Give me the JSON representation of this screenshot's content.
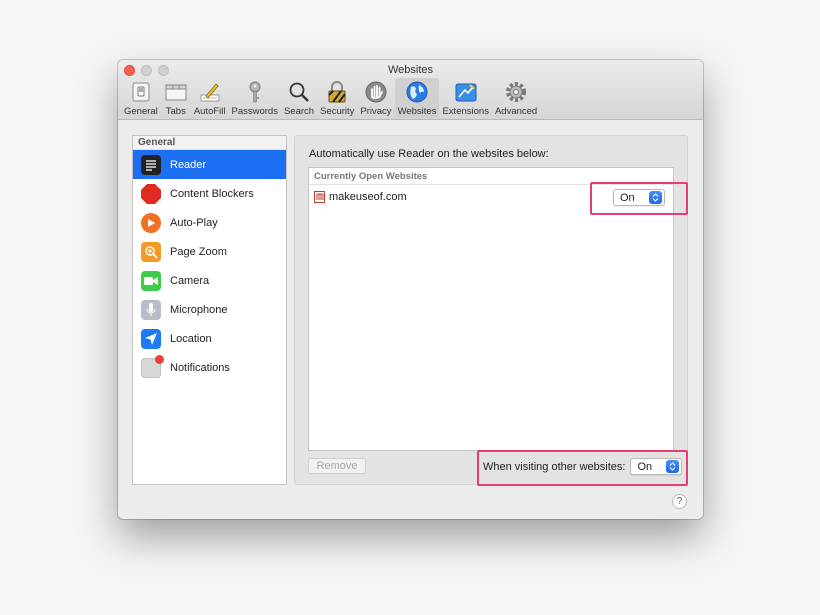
{
  "window": {
    "title": "Websites"
  },
  "toolbar": {
    "items": [
      {
        "label": "General",
        "icon": "general-switch-icon"
      },
      {
        "label": "Tabs",
        "icon": "tabs-icon"
      },
      {
        "label": "AutoFill",
        "icon": "autofill-pencil-icon"
      },
      {
        "label": "Passwords",
        "icon": "key-icon"
      },
      {
        "label": "Search",
        "icon": "magnifier-icon"
      },
      {
        "label": "Security",
        "icon": "padlock-icon"
      },
      {
        "label": "Privacy",
        "icon": "hand-icon"
      },
      {
        "label": "Websites",
        "icon": "globe-icon"
      },
      {
        "label": "Extensions",
        "icon": "puzzle-extensions-icon"
      },
      {
        "label": "Advanced",
        "icon": "gear-icon"
      }
    ],
    "active": "Websites"
  },
  "sidebar": {
    "header": "General",
    "items": [
      {
        "label": "Reader",
        "icon": "reader-icon",
        "color": "#222222"
      },
      {
        "label": "Content Blockers",
        "icon": "stop-sign-icon",
        "color": "#e02b20"
      },
      {
        "label": "Auto-Play",
        "icon": "play-icon",
        "color": "#f27022"
      },
      {
        "label": "Page Zoom",
        "icon": "zoom-icon",
        "color": "#f39a22"
      },
      {
        "label": "Camera",
        "icon": "camera-icon",
        "color": "#3ccc4a"
      },
      {
        "label": "Microphone",
        "icon": "microphone-icon",
        "color": "#b8bec8"
      },
      {
        "label": "Location",
        "icon": "location-arrow-icon",
        "color": "#1c7bf5"
      },
      {
        "label": "Notifications",
        "icon": "notifications-icon",
        "color": "#d8d8d8"
      }
    ],
    "selected": "Reader"
  },
  "content": {
    "description": "Automatically use Reader on the websites below:",
    "table_header": "Currently Open Websites",
    "sites": [
      {
        "name": "makeuseof.com",
        "setting": "On"
      }
    ],
    "remove_label": "Remove",
    "visiting_label": "When visiting other websites:",
    "visiting_value": "On"
  },
  "help": {
    "label": "?"
  },
  "colors": {
    "accent": "#1c6ff3",
    "highlight": "#e83d6f"
  }
}
